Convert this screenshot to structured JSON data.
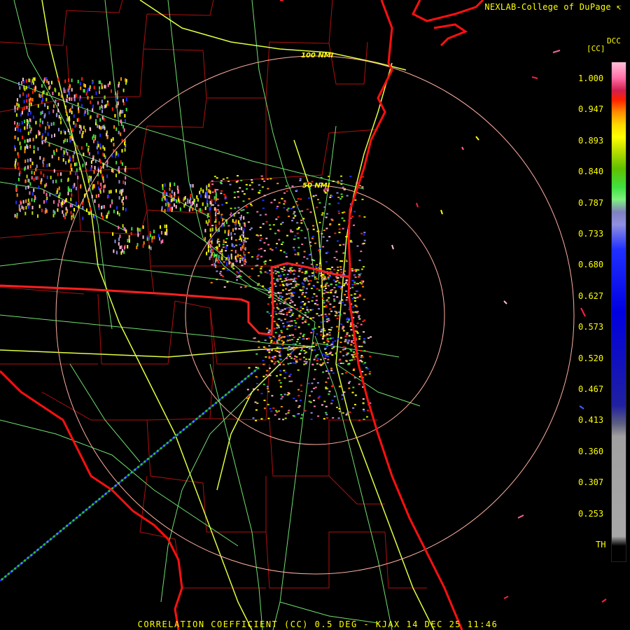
{
  "header": {
    "credit": "NEXLAB-College of DuPage",
    "credit_mark": "↸",
    "product_code": "DCC",
    "units": "[CC]"
  },
  "range_rings": {
    "inner_label": "50 NMI",
    "outer_label": "100 NMI"
  },
  "color_scale": {
    "ticks": [
      "1.000",
      "0.947",
      "0.893",
      "0.840",
      "0.787",
      "0.733",
      "0.680",
      "0.627",
      "0.573",
      "0.520",
      "0.467",
      "0.413",
      "0.360",
      "0.307",
      "0.253",
      "TH"
    ],
    "stops": [
      {
        "value": 1.0,
        "color": "#ffc0d8"
      },
      {
        "value": 0.975,
        "color": "#ff70a8"
      },
      {
        "value": 0.955,
        "color": "#d02050"
      },
      {
        "value": 0.94,
        "color": "#ff2000"
      },
      {
        "value": 0.92,
        "color": "#ff8c00"
      },
      {
        "value": 0.9,
        "color": "#ffd800"
      },
      {
        "value": 0.88,
        "color": "#ffff00"
      },
      {
        "value": 0.86,
        "color": "#c0e000"
      },
      {
        "value": 0.83,
        "color": "#60c000"
      },
      {
        "value": 0.8,
        "color": "#40e040"
      },
      {
        "value": 0.78,
        "color": "#80f080"
      },
      {
        "value": 0.76,
        "color": "#8080c0"
      },
      {
        "value": 0.74,
        "color": "#9090e0"
      },
      {
        "value": 0.7,
        "color": "#2030ff"
      },
      {
        "value": 0.6,
        "color": "#0000e0"
      },
      {
        "value": 0.45,
        "color": "#2020a0"
      },
      {
        "value": 0.42,
        "color": "#606080"
      },
      {
        "value": 0.4,
        "color": "#a0a0a0"
      },
      {
        "value": 0.24,
        "color": "#a8a8a8"
      },
      {
        "value": 0.225,
        "color": "#000000"
      }
    ]
  },
  "colors": {
    "state_border": "#ff2020",
    "coast": "#ff1010",
    "county": "#b01010",
    "highway": "#e0ff40",
    "road": "#70e070",
    "ring": "#ffb0a0",
    "labels": "#ffff00"
  },
  "footer": {
    "text": "CORRELATION COEFFICIENT (CC) 0.5 DEG - KJAX 14 DEC 25 11:46"
  }
}
